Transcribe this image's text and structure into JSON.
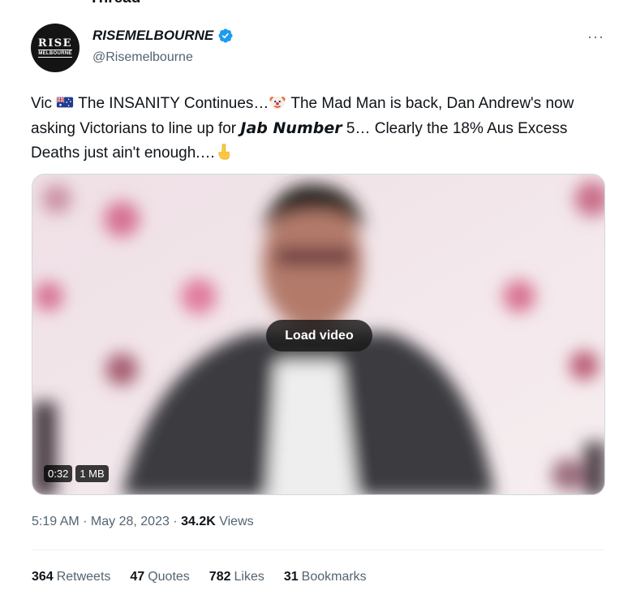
{
  "thread_label": "Thread",
  "author": {
    "avatar_top": "RISE",
    "avatar_bottom": "MELBOURNE",
    "display_name": "RISEMELBOURNE",
    "handle": "@Risemelbourne",
    "verified_icon": "verified-badge-icon"
  },
  "more_label": "···",
  "tweet": {
    "part1": "Vic ",
    "flag_icon": "australia-flag-icon",
    "part2": " The INSANITY Continues…",
    "clown_icon": "clown-face-icon",
    "part3": " The Mad Man is back, Dan Andrew's now asking Victorians to line up for ",
    "bold_italic": "𝙅𝙖𝙗 𝙉𝙪𝙢𝙗𝙚𝙧",
    "part4": " 5… Clearly the 18% Aus Excess Deaths just ain't enough.…",
    "point_icon": "point-down-icon"
  },
  "media": {
    "load_label": "Load video",
    "duration": "0:32",
    "size": "1 MB"
  },
  "meta": {
    "time": "5:19 AM",
    "sep": " · ",
    "date": "May 28, 2023",
    "views_count": "34.2K",
    "views_label": " Views"
  },
  "stats": [
    {
      "count": "364",
      "label": "Retweets"
    },
    {
      "count": "47",
      "label": "Quotes"
    },
    {
      "count": "782",
      "label": "Likes"
    },
    {
      "count": "31",
      "label": "Bookmarks"
    }
  ],
  "colors": {
    "verified": "#1d9bf0",
    "secondary_text": "#536471",
    "primary_text": "#0f1419"
  }
}
